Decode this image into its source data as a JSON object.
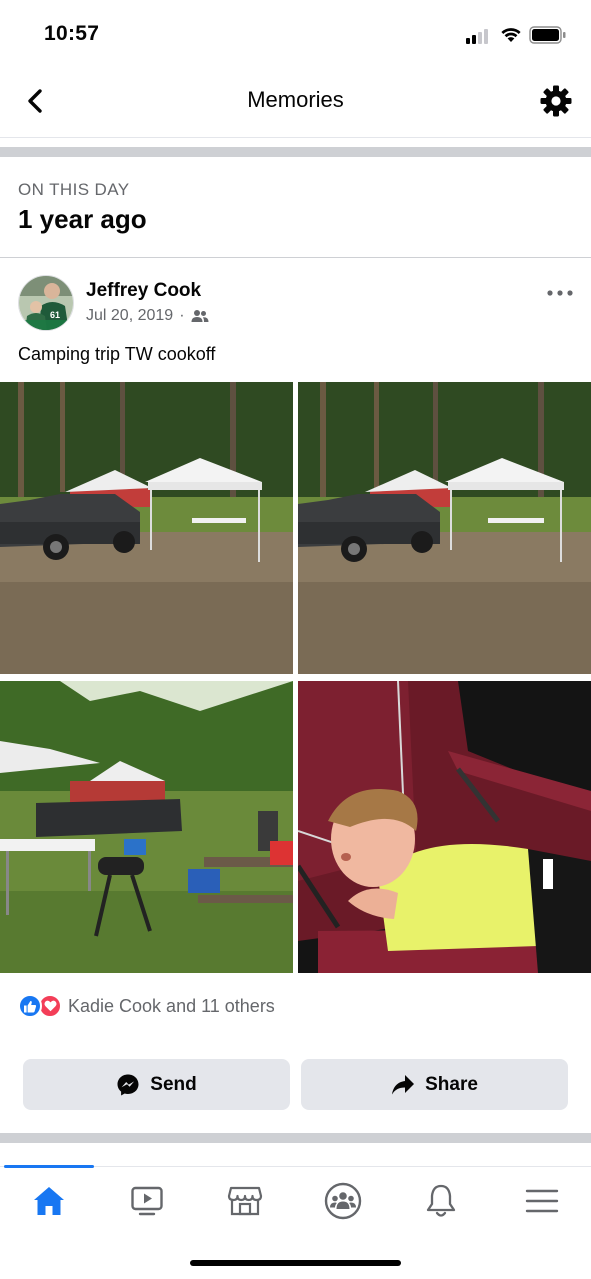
{
  "status_bar": {
    "time": "10:57"
  },
  "header": {
    "title": "Memories"
  },
  "on_this_day": {
    "label": "ON THIS DAY",
    "title": "1 year ago"
  },
  "post": {
    "author": "Jeffrey Cook",
    "date": "Jul 20, 2019",
    "separator": "·",
    "audience_icon": "friends-icon",
    "caption": "Camping trip TW cookoff",
    "photos": [
      {
        "description": "campsite-truck-canopy-1"
      },
      {
        "description": "campsite-truck-canopy-2"
      },
      {
        "description": "campsite-grill-cooler"
      },
      {
        "description": "child-sleeping-in-chair"
      }
    ],
    "reactions": {
      "types": [
        "like",
        "love"
      ],
      "text": "Kadie Cook and 11 others"
    },
    "actions": {
      "send_label": "Send",
      "share_label": "Share"
    }
  },
  "tab_bar": {
    "tabs": [
      {
        "icon": "home-icon",
        "active": true
      },
      {
        "icon": "watch-icon",
        "active": false
      },
      {
        "icon": "marketplace-icon",
        "active": false
      },
      {
        "icon": "groups-icon",
        "active": false
      },
      {
        "icon": "notifications-icon",
        "active": false
      },
      {
        "icon": "menu-icon",
        "active": false
      }
    ]
  },
  "colors": {
    "accent": "#1877f2",
    "love": "#f33e58",
    "secondary_text": "#65676b",
    "button_bg": "#e4e6eb",
    "divider": "#ced0d4"
  }
}
